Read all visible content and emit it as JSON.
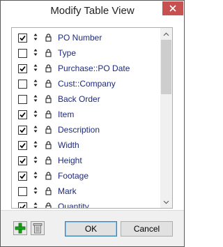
{
  "window": {
    "title": "Modify Table View"
  },
  "columns": [
    {
      "label": "PO Number",
      "checked": true
    },
    {
      "label": "Type",
      "checked": false
    },
    {
      "label": "Purchase::PO Date",
      "checked": true
    },
    {
      "label": "Cust::Company",
      "checked": false
    },
    {
      "label": "Back Order",
      "checked": false
    },
    {
      "label": "Item",
      "checked": true
    },
    {
      "label": "Description",
      "checked": true
    },
    {
      "label": "Width",
      "checked": true
    },
    {
      "label": "Height",
      "checked": true
    },
    {
      "label": "Footage",
      "checked": true
    },
    {
      "label": "Mark",
      "checked": false
    },
    {
      "label": "Quantity",
      "checked": true
    }
  ],
  "buttons": {
    "ok": "OK",
    "cancel": "Cancel"
  },
  "colors": {
    "close_button": "#c75050",
    "label_text": "#1f2a7a",
    "add_icon": "#1aa31a"
  },
  "icons": {
    "close": "close-icon",
    "add": "add-column-icon",
    "delete": "trash-icon",
    "move": "up-down-arrow-icon",
    "lock": "lock-icon"
  }
}
